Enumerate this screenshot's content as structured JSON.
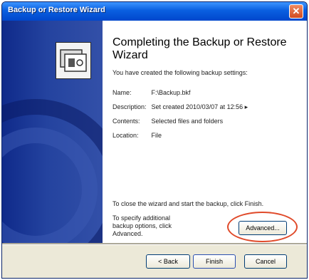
{
  "window": {
    "title": "Backup or Restore Wizard",
    "close_glyph": "✕"
  },
  "content": {
    "heading": "Completing the Backup or Restore Wizard",
    "intro": "You have created the following backup settings:",
    "settings": [
      {
        "label": "Name:",
        "value": "F:\\Backup.bkf"
      },
      {
        "label": "Description:",
        "value": "Set created 2010/03/07 at 12:56 ▸"
      },
      {
        "label": "Contents:",
        "value": "Selected files and folders"
      },
      {
        "label": "Location:",
        "value": "File"
      }
    ],
    "finish_note": "To close the wizard and start the backup, click Finish.",
    "advanced_note": "To specify additional backup options, click Advanced."
  },
  "buttons": {
    "advanced": "Advanced...",
    "back": "< Back",
    "finish": "Finish",
    "cancel": "Cancel"
  },
  "colors": {
    "titlebar": "#0a5fe0",
    "left_panel": "#24439f",
    "highlight_ring": "#e04a2a"
  }
}
